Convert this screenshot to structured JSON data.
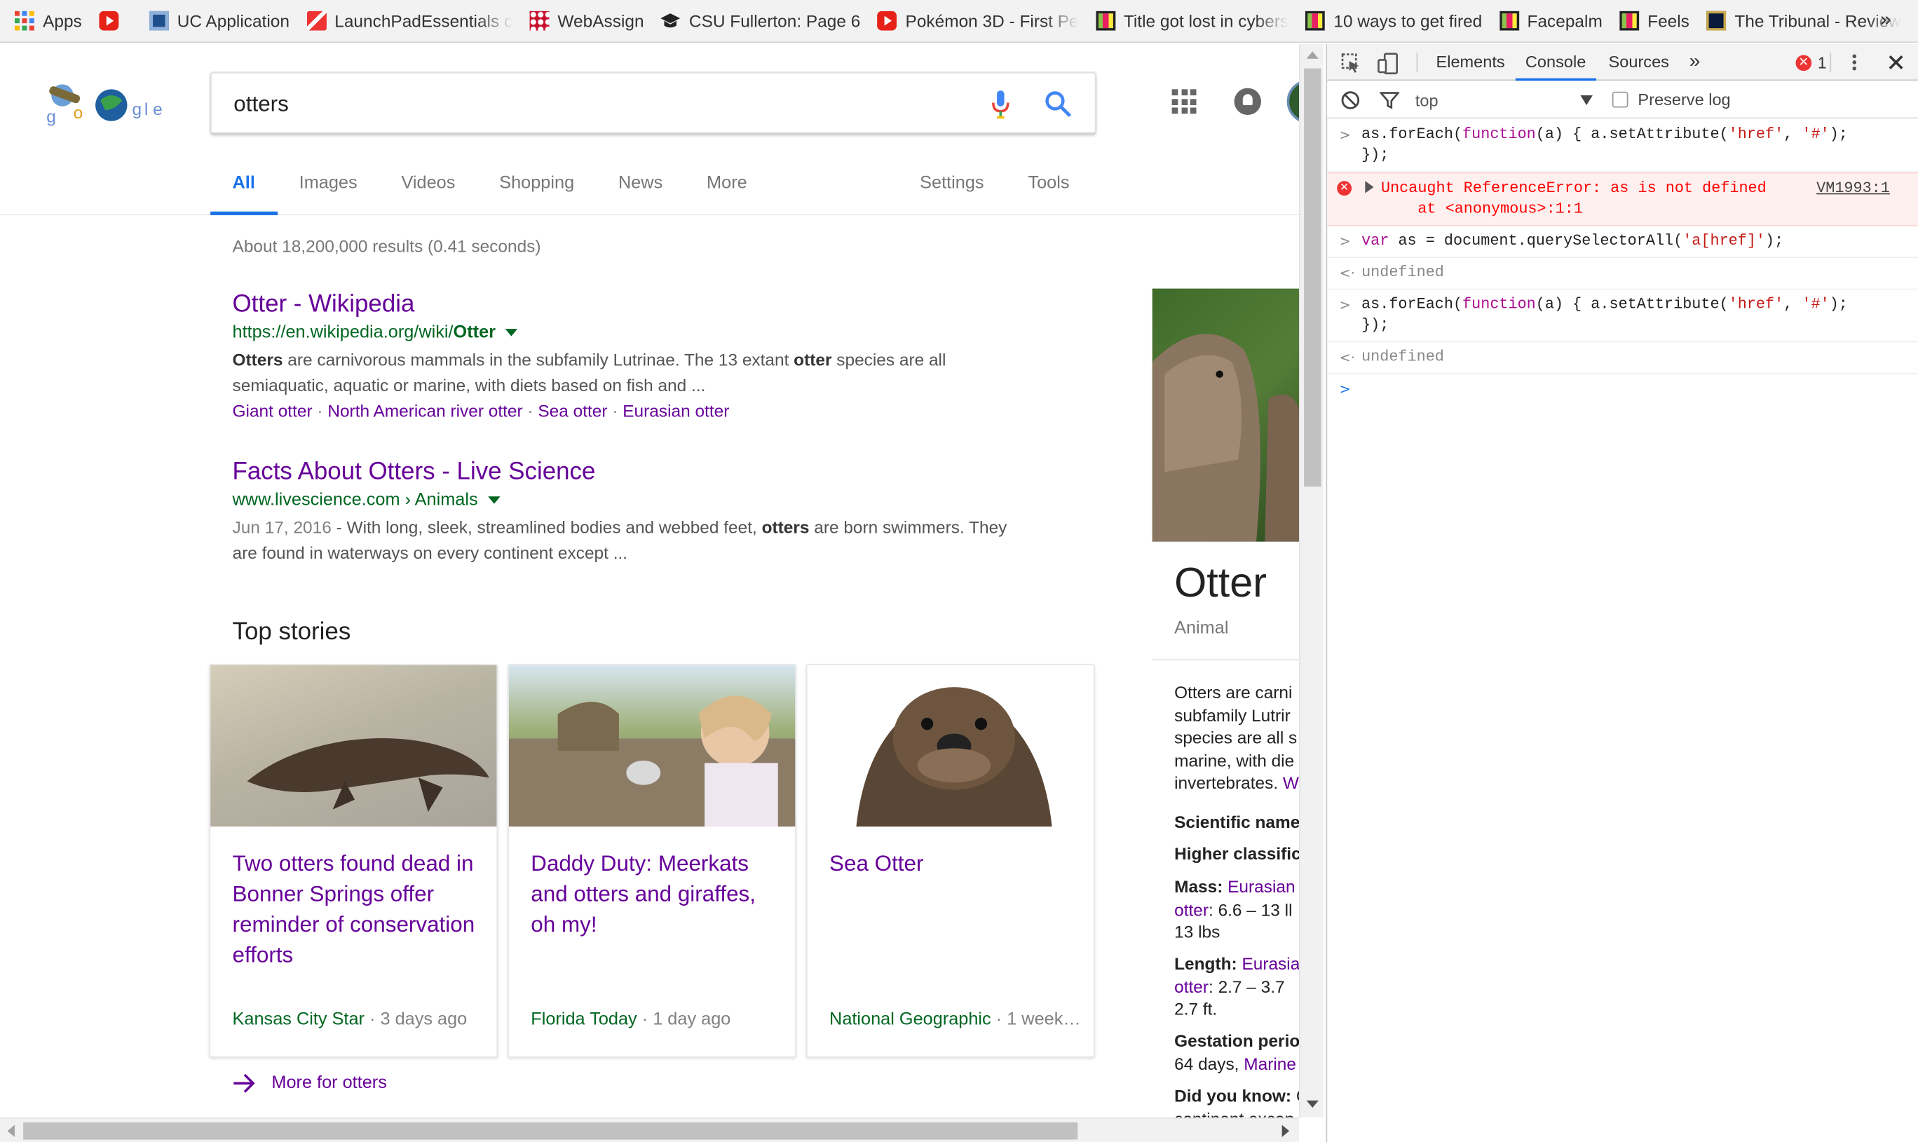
{
  "bookmarks": [
    {
      "label": "Apps",
      "icon": "apps-grid-icon"
    },
    {
      "label": "",
      "icon": "youtube-icon"
    },
    {
      "label": "UC Application",
      "icon": "uc-icon"
    },
    {
      "label": "LaunchPadEssentials c",
      "icon": "launchpad-icon"
    },
    {
      "label": "WebAssign",
      "icon": "webassign-icon"
    },
    {
      "label": "CSU Fullerton: Page 6",
      "icon": "graduation-cap-icon"
    },
    {
      "label": "Pokémon 3D - First Pe",
      "icon": "youtube-icon"
    },
    {
      "label": "Title got lost in cybers",
      "icon": "colorful-square-icon"
    },
    {
      "label": "10 ways to get fired",
      "icon": "colorful-square-icon"
    },
    {
      "label": "Facepalm",
      "icon": "colorful-square-icon"
    },
    {
      "label": "Feels",
      "icon": "colorful-square-icon"
    },
    {
      "label": "The Tribunal - Review",
      "icon": "league-icon"
    }
  ],
  "bookmarks_overflow": "»",
  "search": {
    "query": "otters"
  },
  "tabs": [
    "All",
    "Images",
    "Videos",
    "Shopping",
    "News",
    "More"
  ],
  "tabs_right": [
    "Settings",
    "Tools"
  ],
  "stats": "About 18,200,000 results (0.41 seconds)",
  "results": [
    {
      "title": "Otter - Wikipedia",
      "url_pre": "https://en.wikipedia.org/wiki/",
      "url_bold": "Otter",
      "snip_line1_a": "Otters",
      "snip_line1_b": " are carnivorous mammals in the subfamily Lutrinae. The 13 extant ",
      "snip_line1_c": "otter",
      "snip_line1_d": " species are all",
      "snip_line2": "semiaquatic, aquatic or marine, with diets based on fish and ...",
      "links": [
        "Giant otter",
        "North American river otter",
        "Sea otter",
        "Eurasian otter"
      ]
    },
    {
      "title": "Facts About Otters - Live Science",
      "url_pre": "www.livescience.com › Animals",
      "date": "Jun 17, 2016",
      "snip_a": " - With long, sleek, streamlined bodies and webbed feet, ",
      "snip_b": "otters",
      "snip_c": " are born swimmers. They",
      "snip_line2": "are found in waterways on every continent except ..."
    }
  ],
  "top_stories": {
    "heading": "Top stories",
    "cards": [
      {
        "title": "Two otters found dead in Bonner Springs offer reminder of conservation efforts",
        "source": "Kansas City Star",
        "age": " · 3 days ago"
      },
      {
        "title": "Daddy Duty: Meerkats and otters and giraffes, oh my!",
        "source": "Florida Today",
        "age": " · 1 day ago"
      },
      {
        "title": "Sea Otter",
        "source": "National Geographic",
        "age": " · 1 week a..."
      }
    ],
    "more": "More for otters"
  },
  "knowledge_panel": {
    "name": "Otter",
    "type": "Animal",
    "body_lines": [
      "Otters are carni",
      "subfamily Lutrir",
      "species are all s",
      "marine, with die",
      "invertebrates. "
    ],
    "body_link": "W",
    "sci_name_label": "Scientific name",
    "higher_class_label": "Higher classific",
    "mass_label": "Mass: ",
    "mass_link_a": "Eurasian",
    "mass_link_b": "otter",
    "mass_val_a": ": 6.6 – 13 ll",
    "mass_val_b": "13 lbs",
    "length_label": "Length: ",
    "length_link_a": "Eurasia",
    "length_link_b": "otter",
    "length_val_a": ": 2.7 – 3.7 ",
    "length_val_b": "2.7 ft.",
    "gestation_label": "Gestation perio",
    "gestation_val": "64 days, ",
    "gestation_link": "Marine",
    "didyouknow_label": "Did you know: ",
    "didyouknow_val": "C",
    "didyouknow_val2": "continent excep"
  },
  "devtools": {
    "tabs": [
      "Elements",
      "Console",
      "Sources"
    ],
    "active_tab": "Console",
    "more_tabs": "»",
    "error_count": "1",
    "context": "top",
    "preserve_log": "Preserve log",
    "lines": [
      {
        "kind": "input",
        "text_a": "as.forEach(",
        "kw": "function",
        "text_b": "(a) { a.setAttribute(",
        "s1": "'href'",
        "text_c": ", ",
        "s2": "'#'",
        "text_d": ");",
        "line2": "});"
      },
      {
        "kind": "error",
        "text": "Uncaught ReferenceError: as is not defined",
        "line2": "    at <anonymous>:1:1",
        "source": "VM1993:1"
      },
      {
        "kind": "input2",
        "kw": "var",
        "text_a": " as = document.querySelectorAll(",
        "s1": "'a[href]'",
        "text_b": ");"
      },
      {
        "kind": "output",
        "text": "undefined"
      },
      {
        "kind": "input",
        "text_a": "as.forEach(",
        "kw": "function",
        "text_b": "(a) { a.setAttribute(",
        "s1": "'href'",
        "text_c": ", ",
        "s2": "'#'",
        "text_d": ");",
        "line2": "});"
      },
      {
        "kind": "output",
        "text": "undefined"
      }
    ]
  },
  "colors": {
    "link_visited": "#660099",
    "url_green": "#006621",
    "accent_blue": "#1a73e8",
    "error_red": "#ff0000"
  }
}
